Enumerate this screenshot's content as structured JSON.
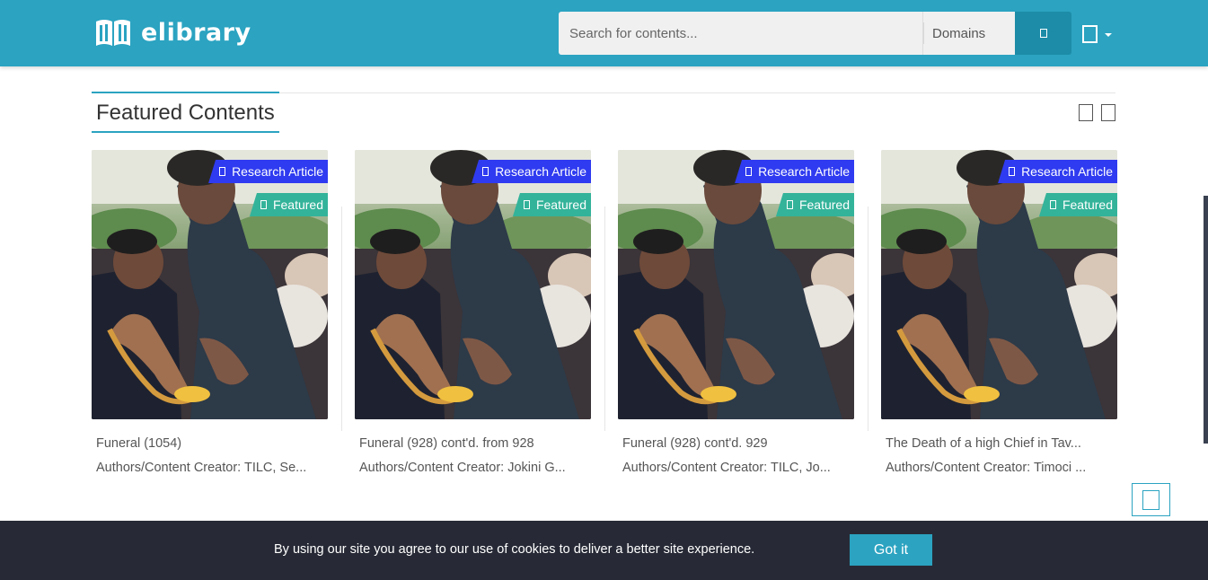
{
  "brand": {
    "logo_text": "elibrary",
    "color": "#2ba3c1"
  },
  "search": {
    "placeholder": "Search for contents...",
    "domains_label": "Domains",
    "button_icon": "search-icon"
  },
  "user_menu": {
    "icon": "user-icon"
  },
  "section": {
    "title": "Featured Contents",
    "prev_icon": "arrow-left-icon",
    "next_icon": "arrow-right-icon"
  },
  "cards": [
    {
      "type_badge": "Research Article",
      "featured_badge": "Featured",
      "title": "Funeral (1054)",
      "authors": "Authors/Content Creator: TILC, Se..."
    },
    {
      "type_badge": "Research Article",
      "featured_badge": "Featured",
      "title": "Funeral (928) cont'd. from 928",
      "authors": "Authors/Content Creator: Jokini G..."
    },
    {
      "type_badge": "Research Article",
      "featured_badge": "Featured",
      "title": "Funeral (928) cont'd. 929",
      "authors": "Authors/Content Creator: TILC, Jo..."
    },
    {
      "type_badge": "Research Article",
      "featured_badge": "Featured",
      "title": "The Death of a high Chief in Tav...",
      "authors": "Authors/Content Creator: Timoci ..."
    }
  ],
  "colors": {
    "research_badge": "#2f3bf0",
    "featured_badge": "#33b39a",
    "cookie_bg": "#272a36"
  },
  "cookie": {
    "message": "By using our site you agree to our use of cookies to deliver a better site experience.",
    "button_label": "Got it"
  }
}
